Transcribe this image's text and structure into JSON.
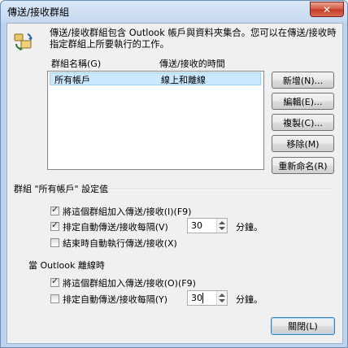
{
  "window": {
    "title": "傳送/接收群組",
    "close_label": "✕"
  },
  "intro_text": "傳送/接收群組包含 Outlook 帳戶與資料夾集合。您可以在傳送/接收時指定群組上所要執行的工作。",
  "list": {
    "col_name": "群組名稱(G)",
    "col_time": "傳送/接收的時間",
    "rows": [
      {
        "name": "所有帳戶",
        "time": "線上和離線"
      }
    ]
  },
  "buttons": {
    "new": "新增(N)...",
    "edit": "編輯(E)...",
    "copy": "複製(C)...",
    "remove": "移除(M)",
    "rename": "重新命名(R)",
    "close": "關閉(L)"
  },
  "group_settings_label": "群組 \"所有帳戶\" 設定值",
  "online": {
    "include_label": "將這個群組加入傳送/接收(I)(F9)",
    "include_checked": true,
    "schedule_label": "排定自動傳送/接收每隔(V)",
    "schedule_checked": true,
    "schedule_minutes": "30",
    "unit": "分鐘。",
    "on_exit_label": "結束時自動執行傳送/接收(X)",
    "on_exit_checked": false
  },
  "offline_label": "當 Outlook 離線時",
  "offline": {
    "include_label": "將這個群組加入傳送/接收(O)(F9)",
    "include_checked": true,
    "schedule_label": "排定自動傳送/接收每隔(Y)",
    "schedule_checked": false,
    "schedule_minutes": "30",
    "unit": "分鐘。"
  },
  "icons": {
    "dialog": "send-receive-groups-icon"
  }
}
